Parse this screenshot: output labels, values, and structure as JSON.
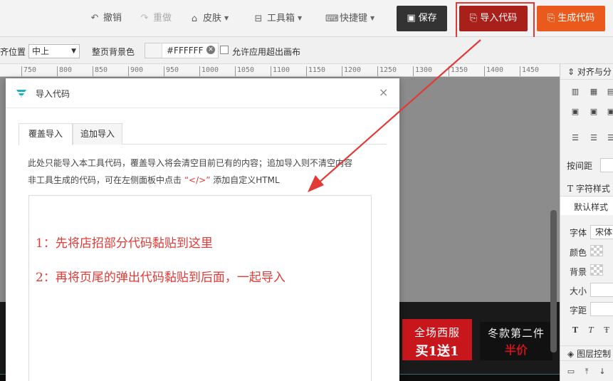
{
  "toolbar": {
    "undo": "撤销",
    "redo": "重做",
    "skin": "皮肤",
    "toolbox": "工具箱",
    "shortcuts": "快捷键",
    "save": "保存",
    "import_code": "导入代码",
    "generate_code": "生成代码"
  },
  "propbar": {
    "align_label": "齐位置",
    "align_value": "中上",
    "bg_label": "整页背景色",
    "bg_value": "#FFFFFF",
    "overflow_label": "允许应用超出画布"
  },
  "ruler": [
    "750",
    "800",
    "850",
    "900",
    "950",
    "1000",
    "1050",
    "1100",
    "1150",
    "1200",
    "1250",
    "1300",
    "1350",
    "1400",
    "1450"
  ],
  "right_panel": {
    "align_header": "对齐与分",
    "spacing_label": "按间距",
    "text_header": "字符样式",
    "default_style": "默认样式",
    "font_label": "字体",
    "font_value": "宋体",
    "color_label": "颜色",
    "bg_label": "背景",
    "size_label": "大小",
    "letter_spacing_label": "字距",
    "layer_header": "图层控制"
  },
  "banner": {
    "promo1_line1": "全场西服",
    "promo1_line2": "买1送1",
    "promo2_line1": "冬款第二件",
    "promo2_line2": "半价"
  },
  "dialog": {
    "title": "导入代码",
    "close": "×",
    "tab_overwrite": "覆盖导入",
    "tab_append": "追加导入",
    "desc1": "此处只能导入本工具代码，覆盖导入将会清空目前已有的内容；追加导入则不清空内容",
    "desc2_pre": "非工具生成的代码，可在左侧面板中点击",
    "desc2_code": "“</>”",
    "desc2_post": "添加自定义HTML",
    "note1": "1：先将店招部分代码黏贴到这里",
    "note2": "2：再将页尾的弹出代码黏贴到后面，一起导入"
  },
  "colors": {
    "save_btn": "#333333",
    "import_btn": "#a91f1a",
    "generate_btn": "#e95a1c",
    "annotation": "#e23a36"
  },
  "icons": {
    "undo": "undo-icon",
    "redo": "redo-icon",
    "skin": "shirt-icon",
    "toolbox": "toolbox-icon",
    "shortcuts": "keyboard-icon",
    "save": "save-icon",
    "import": "import-icon",
    "generate": "export-icon"
  }
}
